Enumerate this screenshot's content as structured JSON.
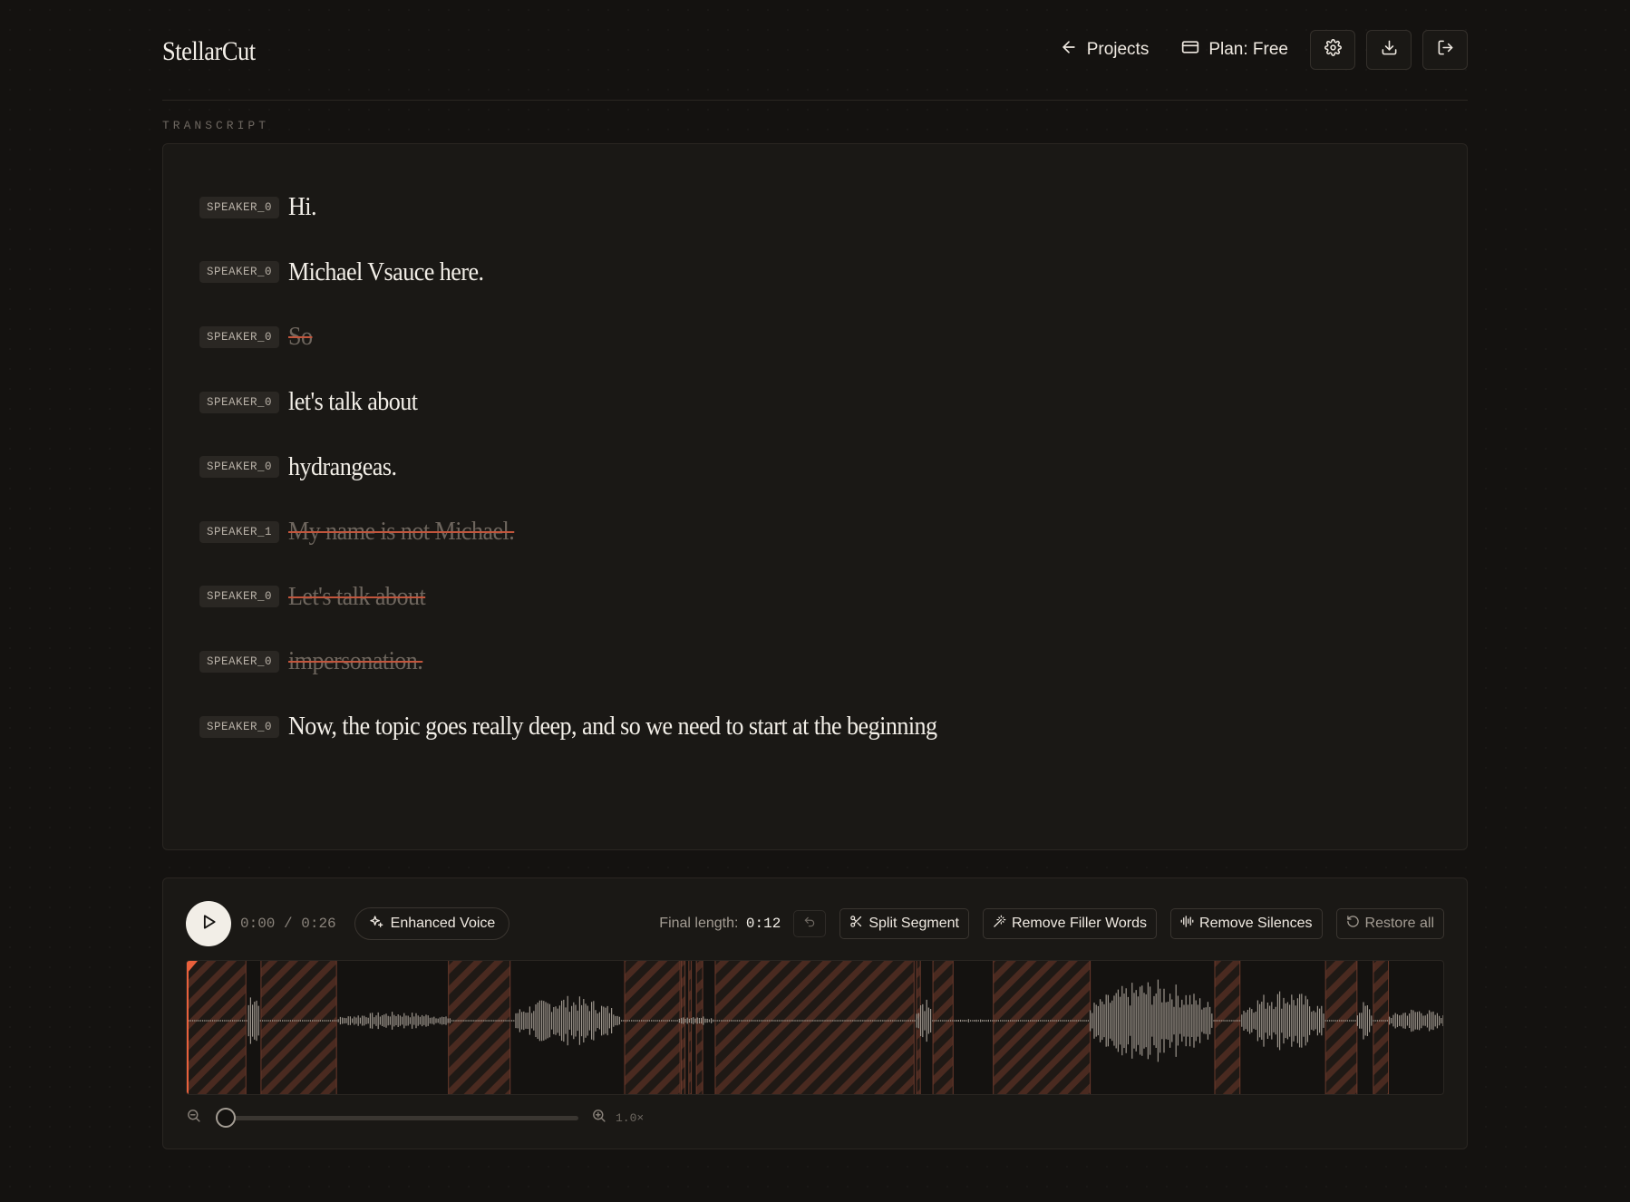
{
  "app": {
    "title": "StellarCut"
  },
  "header": {
    "projects_label": "Projects",
    "plan_label": "Plan: Free"
  },
  "transcript": {
    "section_label": "TRANSCRIPT",
    "rows": [
      {
        "speaker": "SPEAKER_0",
        "text": "Hi.",
        "removed": false
      },
      {
        "speaker": "SPEAKER_0",
        "text": "Michael Vsauce here.",
        "removed": false
      },
      {
        "speaker": "SPEAKER_0",
        "text": "So",
        "removed": true
      },
      {
        "speaker": "SPEAKER_0",
        "text": "let's talk about",
        "removed": false
      },
      {
        "speaker": "SPEAKER_0",
        "text": "hydrangeas.",
        "removed": false
      },
      {
        "speaker": "SPEAKER_1",
        "text": "My name is not Michael.",
        "removed": true
      },
      {
        "speaker": "SPEAKER_0",
        "text": "Let's talk about",
        "removed": true
      },
      {
        "speaker": "SPEAKER_0",
        "text": "impersonation.",
        "removed": true
      },
      {
        "speaker": "SPEAKER_0",
        "text": "Now, the topic goes really deep, and so we need to start at the beginning",
        "removed": false
      }
    ]
  },
  "player": {
    "time_current": "0:00",
    "time_total": "0:26",
    "time_separator": "/",
    "enhanced_voice_label": "Enhanced Voice",
    "final_length_label": "Final length:",
    "final_length_value": "0:12",
    "split_segment_label": "Split Segment",
    "remove_filler_label": "Remove Filler Words",
    "remove_silences_label": "Remove Silences",
    "restore_all_label": "Restore all",
    "zoom_label": "1.0×",
    "zoom_level": 1.0,
    "playhead_fraction": 0.0
  },
  "waveform": {
    "duration_fraction_note_free": true,
    "removed_regions": [
      [
        0.0,
        0.047
      ],
      [
        0.059,
        0.119
      ],
      [
        0.208,
        0.257
      ],
      [
        0.348,
        0.392
      ],
      [
        0.393,
        0.396
      ],
      [
        0.399,
        0.401
      ],
      [
        0.405,
        0.41
      ],
      [
        0.42,
        0.578
      ],
      [
        0.58,
        0.583
      ],
      [
        0.593,
        0.609
      ],
      [
        0.641,
        0.718
      ],
      [
        0.817,
        0.837
      ],
      [
        0.905,
        0.93
      ],
      [
        0.943,
        0.955
      ]
    ]
  },
  "colors": {
    "accent": "#e8603c",
    "removed_stripe": "#4a2a20",
    "waveform": "#9c958c"
  },
  "icons": {
    "projects": "arrow-left-icon",
    "plan": "credit-card-icon",
    "settings": "gear-icon",
    "download": "download-icon",
    "logout": "logout-icon",
    "play": "play-icon",
    "enhanced_voice": "sparkles-icon",
    "undo": "undo-icon",
    "split": "scissors-icon",
    "filler": "wand-icon",
    "silences": "audio-lines-icon",
    "restore": "rotate-ccw-icon",
    "zoom_out": "zoom-out-icon",
    "zoom_in": "zoom-in-icon"
  }
}
